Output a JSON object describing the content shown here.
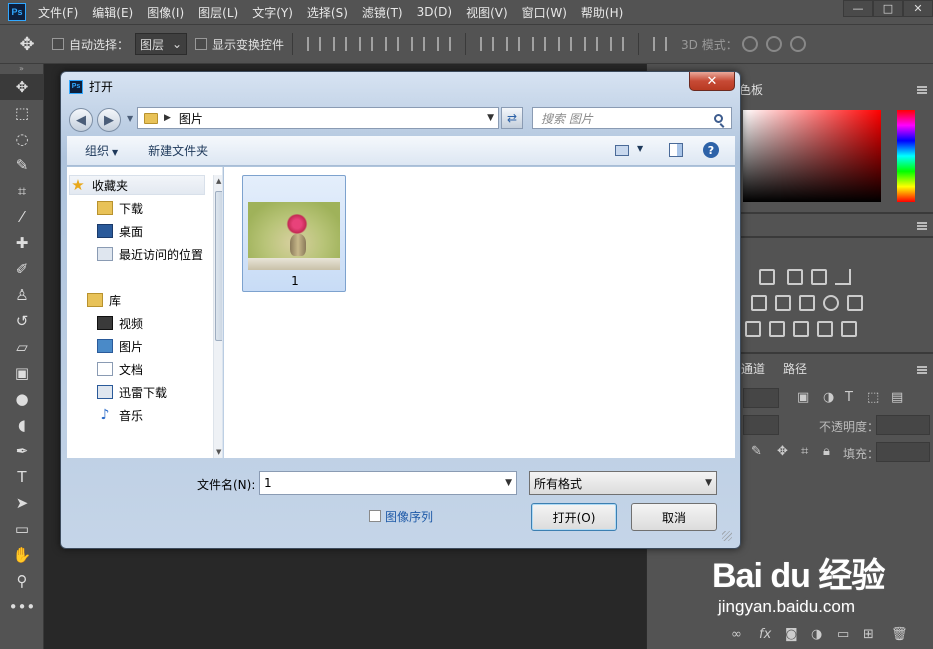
{
  "app": {
    "logo": "Ps",
    "menu": [
      "文件(F)",
      "编辑(E)",
      "图像(I)",
      "图层(L)",
      "文字(Y)",
      "选择(S)",
      "滤镜(T)",
      "3D(D)",
      "视图(V)",
      "窗口(W)",
      "帮助(H)"
    ],
    "window_buttons": [
      "—",
      "□",
      "✕"
    ]
  },
  "options_bar": {
    "auto_select_label": "自动选择：",
    "auto_select_value": "图层",
    "show_transform_label": "显示变换控件",
    "mode_3d_label": "3D 模式："
  },
  "right_panel": {
    "color_tab": "色板",
    "channels_tab": "通道",
    "paths_tab": "路径",
    "opacity_label": "不透明度：",
    "fill_label": "填充："
  },
  "watermark": {
    "logo": "Bai du 经验",
    "url": "jingyan.baidu.com"
  },
  "dialog": {
    "title": "打开",
    "close": "✕",
    "address": "图片",
    "search_placeholder": "搜索 图片",
    "toolbar": {
      "organize": "组织",
      "new_folder": "新建文件夹"
    },
    "nav": {
      "favorites": "收藏夹",
      "downloads": "下载",
      "desktop": "桌面",
      "recent": "最近访问的位置",
      "libraries": "库",
      "videos": "视频",
      "pictures": "图片",
      "documents": "文档",
      "thunder": "迅雷下载",
      "music": "音乐"
    },
    "files": [
      {
        "name": "1"
      }
    ],
    "filename_label": "文件名(N):",
    "filename_value": "1",
    "format_value": "所有格式",
    "sequence_label": "图像序列",
    "open_button": "打开(O)",
    "cancel_button": "取消"
  }
}
